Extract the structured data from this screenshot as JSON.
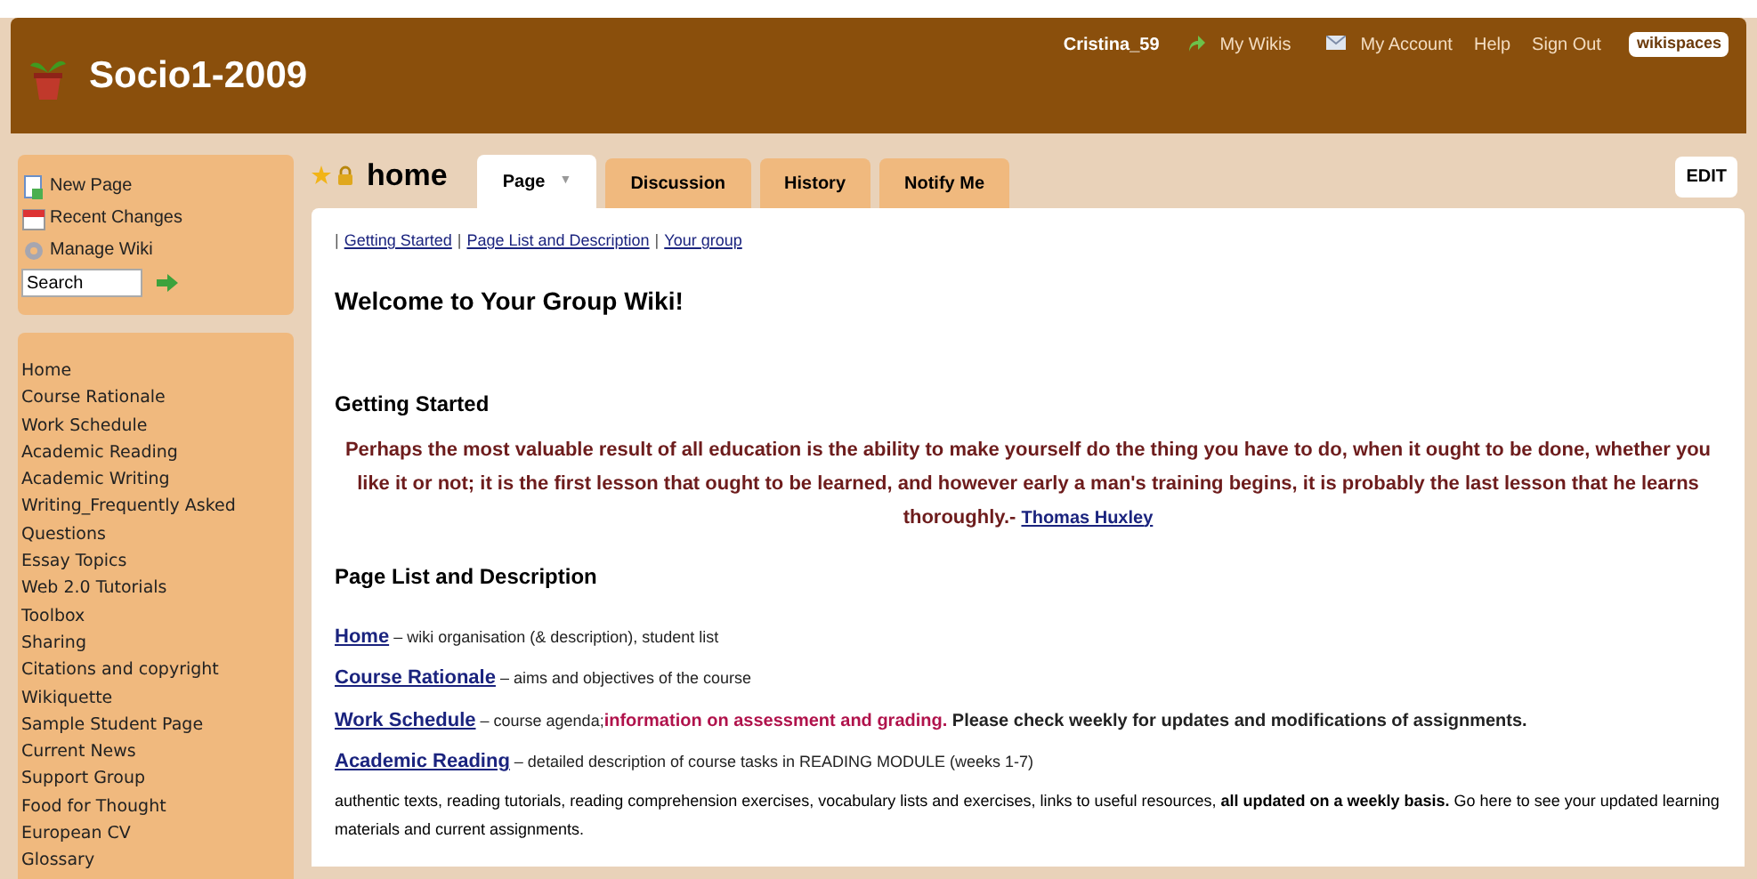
{
  "header": {
    "site_title": "Socio1-2009",
    "user": "Cristina_59",
    "links": [
      "My Wikis",
      "My Account",
      "Help",
      "Sign Out"
    ],
    "brand": "wikispaces"
  },
  "sidebar": {
    "actions": [
      "New Page",
      "Recent Changes",
      "Manage Wiki"
    ],
    "search": {
      "value": "Search"
    },
    "nav": [
      "Home",
      "Course Rationale",
      "Work Schedule",
      "Academic Reading",
      "Academic Writing",
      "Writing_Frequently Asked",
      "Questions",
      "Essay Topics",
      "Web 2.0 Tutorials",
      "Toolbox",
      "Sharing",
      "Citations and copyright",
      "Wikiquette",
      "Sample Student Page",
      "Current News",
      "Support Group",
      "Food for Thought",
      "European CV",
      "Glossary"
    ]
  },
  "page": {
    "title": "home",
    "tabs": [
      {
        "label": "Page",
        "selected": true,
        "caret": "▼"
      },
      {
        "label": "Discussion",
        "selected": false
      },
      {
        "label": "History",
        "selected": false
      },
      {
        "label": "Notify Me",
        "selected": false
      }
    ],
    "edit_button": "EDIT"
  },
  "content": {
    "toc_separator": "|",
    "toc": [
      "Getting Started",
      "Page List and Description",
      "Your group"
    ],
    "welcome": "Welcome to Your Group Wiki!",
    "getting_started": {
      "heading": "Getting Started",
      "quote": "Perhaps the most valuable result of all education is the ability to make yourself do the thing you have to do, when it ought to be done, whether you like it or not; it is the first lesson that ought to be learned, and however early a man's training begins, it is probably the last lesson that he learns thoroughly.-",
      "author": "Thomas Huxley"
    },
    "page_list": {
      "heading": "Page List and Description",
      "items": [
        {
          "link": "Home",
          "text": "– wiki organisation (& description), student list"
        },
        {
          "link": "Course Rationale",
          "text": "– aims and objectives of the course"
        },
        {
          "link": "Work Schedule",
          "text": "– course agenda;",
          "highlight": "information on assessment and grading.",
          "note": "Please check weekly for updates and modifications of assignments."
        },
        {
          "link": "Academic Reading",
          "text": "– detailed description of course tasks in READING MODULE (weeks 1-7)"
        }
      ],
      "paragraph": "authentic texts, reading tutorials, reading comprehension exercises, vocabulary lists and exercises, links to useful resources, **all updated on a weekly basis.** Go here to see your updated learning materials and current assignments."
    }
  }
}
